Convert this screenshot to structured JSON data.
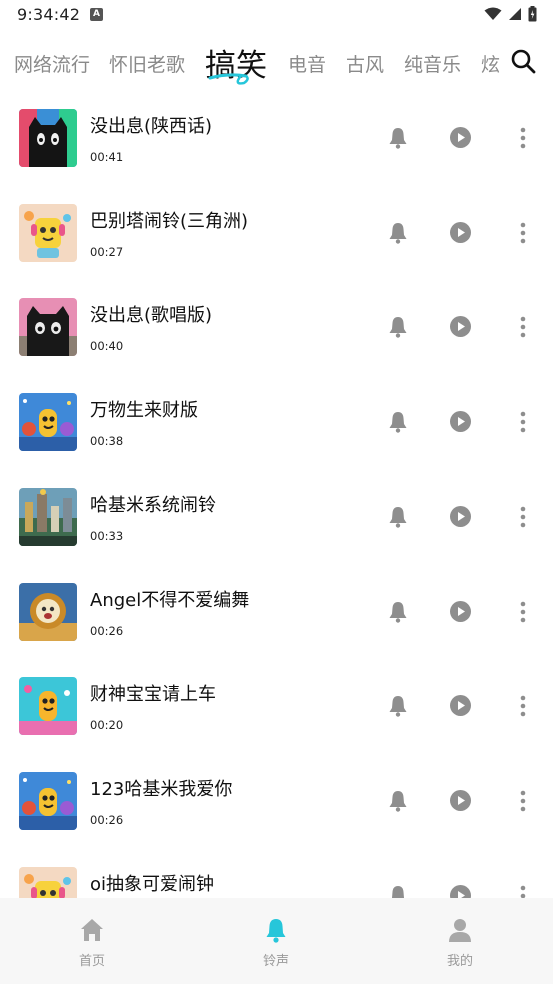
{
  "status_bar": {
    "time": "9:34:42",
    "notification_badge": "A"
  },
  "tabs": [
    {
      "label": "网络流行",
      "active": false
    },
    {
      "label": "怀旧老歌",
      "active": false
    },
    {
      "label": "搞笑",
      "active": true
    },
    {
      "label": "电音",
      "active": false
    },
    {
      "label": "古风",
      "active": false
    },
    {
      "label": "纯音乐",
      "active": false
    },
    {
      "label": "炫",
      "active": false
    }
  ],
  "ringtones": [
    {
      "title": "没出息(陕西话)",
      "duration": "00:41",
      "thumb": "black-cat-red"
    },
    {
      "title": "巴别塔闹铃(三角洲)",
      "duration": "00:27",
      "thumb": "yellow-toy"
    },
    {
      "title": "没出息(歌唱版)",
      "duration": "00:40",
      "thumb": "black-cat-pink"
    },
    {
      "title": "万物生来财版",
      "duration": "00:38",
      "thumb": "cartoon-party"
    },
    {
      "title": "哈基米系统闹铃",
      "duration": "00:33",
      "thumb": "city-scene"
    },
    {
      "title": "Angel不得不爱编舞",
      "duration": "00:26",
      "thumb": "gold-frame"
    },
    {
      "title": "财神宝宝请上车",
      "duration": "00:20",
      "thumb": "cartoon-cyan"
    },
    {
      "title": "123哈基米我爱你",
      "duration": "00:26",
      "thumb": "cartoon-party"
    },
    {
      "title": "oi抽象可爱闹钟",
      "duration": "",
      "thumb": "yellow-toy"
    }
  ],
  "bottom_nav": [
    {
      "label": "首页",
      "icon": "home-icon",
      "active": false
    },
    {
      "label": "铃声",
      "icon": "bell-icon",
      "active": true
    },
    {
      "label": "我的",
      "icon": "user-icon",
      "active": false
    }
  ],
  "colors": {
    "accent": "#26c6da",
    "icon_gray": "#8e8e8e",
    "tab_inactive": "#8a8a8a",
    "nav_bg": "#f7f7f7"
  }
}
